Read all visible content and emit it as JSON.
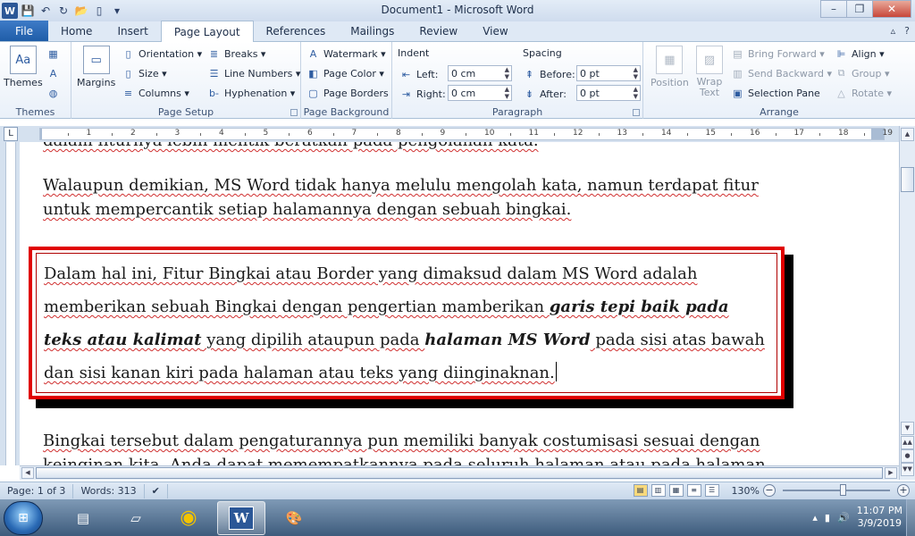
{
  "window": {
    "title": "Document1  -  Microsoft Word",
    "minimize": "–",
    "restore": "❐",
    "close": "✕"
  },
  "qat": {
    "save": "💾",
    "undo": "↶",
    "redo": "↻",
    "open": "📂",
    "new": "▯",
    "more": "▾"
  },
  "tabs": {
    "file": "File",
    "items": [
      "Home",
      "Insert",
      "Page Layout",
      "References",
      "Mailings",
      "Review",
      "View"
    ],
    "active": "Page Layout",
    "right_icons": [
      "▵",
      "?"
    ]
  },
  "ribbon": {
    "themes": {
      "label": "Themes",
      "button": "Themes",
      "colors_icon": "▦",
      "fonts_icon": "A",
      "effects_icon": "◍"
    },
    "page_setup": {
      "label": "Page Setup",
      "margins": "Margins",
      "orientation": "Orientation ▾",
      "size": "Size ▾",
      "columns": "Columns ▾",
      "breaks": "Breaks ▾",
      "line_numbers": "Line Numbers ▾",
      "hyphenation": "Hyphenation ▾"
    },
    "page_background": {
      "label": "Page Background",
      "watermark": "Watermark ▾",
      "page_color": "Page Color ▾",
      "page_borders": "Page Borders"
    },
    "paragraph": {
      "label": "Paragraph",
      "indent": "Indent",
      "left_label": "Left:",
      "left_value": "0 cm",
      "right_label": "Right:",
      "right_value": "0 cm",
      "spacing": "Spacing",
      "before_label": "Before:",
      "before_value": "0 pt",
      "after_label": "After:",
      "after_value": "0 pt"
    },
    "arrange": {
      "label": "Arrange",
      "position": "Position",
      "wrap_text": "Wrap Text",
      "bring_forward": "Bring Forward ▾",
      "send_backward": "Send Backward ▾",
      "selection_pane": "Selection Pane",
      "align": "Align ▾",
      "group": "Group ▾",
      "rotate": "Rotate ▾"
    }
  },
  "ruler": {
    "corner": "L",
    "numbers": [
      "1",
      "2",
      "3",
      "4",
      "5",
      "6",
      "7",
      "8",
      "9",
      "10",
      "11",
      "12",
      "13",
      "14",
      "15",
      "16",
      "17",
      "18",
      "19"
    ],
    "marker": "⌂"
  },
  "document": {
    "line_cut": "dalam fiturnya lebih melitik beratkan pada pengolahan kata.",
    "para1": "Walaupun demikian, MS Word tidak hanya melulu mengolah kata, namun terdapat fitur untuk mempercantik setiap halamannya dengan sebuah bingkai.",
    "boxed": {
      "t1": "Dalam hal ini, Fitur Bingkai atau Border yang dimaksud dalam MS Word adalah memberikan sebuah Bingkai dengan pengertian mamberikan ",
      "b1": "garis tepi baik pada teks atau kalimat",
      "t2": " yang dipilih ataupun pada ",
      "b2": "halaman MS Word",
      "t3": " pada sisi atas bawah dan sisi kanan kiri pada halaman atau teks yang diinginaknan."
    },
    "para3": "Bingkai tersebut dalam pengaturannya pun memiliki banyak costumisasi sesuai dengan keinginan kita. Anda dapat memempatkannya pada seluruh halaman atau pada halaman tertentu"
  },
  "status": {
    "page": "Page: 1 of 3",
    "words": "Words: 313",
    "proof_icon": "✔",
    "zoom": "130%",
    "zoom_out": "−",
    "zoom_in": "+"
  },
  "taskbar": {
    "start_icon": "⊞",
    "apps": [
      {
        "name": "winrar",
        "icon": "▤"
      },
      {
        "name": "notepad",
        "icon": "▱"
      },
      {
        "name": "chrome",
        "icon": "◉"
      },
      {
        "name": "word",
        "icon": "W"
      },
      {
        "name": "paint",
        "icon": "🎨"
      }
    ],
    "time": "11:07 PM",
    "date": "3/9/2019",
    "tray_icons": [
      "▴",
      "▮",
      "🔊"
    ]
  },
  "colors": {
    "accent": "#2b5797",
    "frame_red": "#e00000",
    "file_tab": "#2a69b8"
  }
}
